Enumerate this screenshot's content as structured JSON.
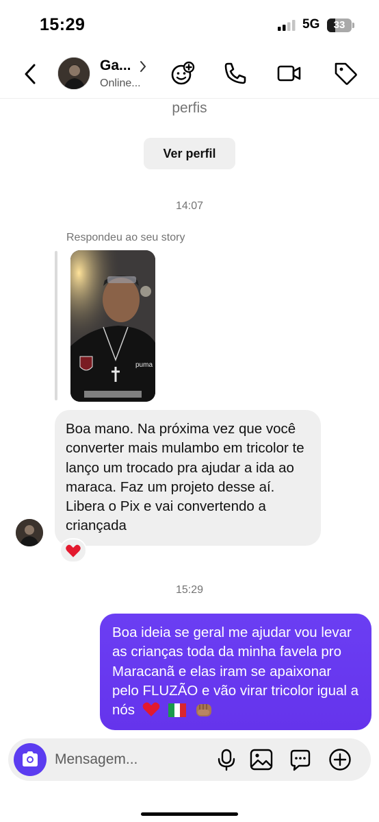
{
  "status_bar": {
    "time": "15:29",
    "network": "5G",
    "battery": "33"
  },
  "header": {
    "contact_name": "Ga...",
    "contact_status": "Online...",
    "icons": [
      "back-chevron-icon",
      "add-sticker-icon",
      "phone-icon",
      "video-camera-icon",
      "tag-icon"
    ]
  },
  "chat": {
    "profile_fragment": "perfis",
    "view_profile_label": "Ver perfil",
    "timestamp_1": "14:07",
    "reply_label": "Respondeu ao seu story",
    "incoming_message": "Boa mano. Na próxima vez que você converter mais mulambo em tricolor te lanço um trocado pra ajudar a ida ao maraca. Faz um projeto desse aí. Libera o Pix e vai convertendo a criançada",
    "reaction": "❤️",
    "timestamp_2": "15:29",
    "outgoing_message": "Boa ideia se geral me ajudar vou levar as crianças toda da minha favela pro Maracanã e elas iram se apaixonar pelo FLUZÃO e vão virar tricolor igual a nós",
    "outgoing_emojis": "❤️ 🇮🇹 👊🏽"
  },
  "composer": {
    "placeholder": "Mensagem...",
    "icons": [
      "camera-icon",
      "microphone-icon",
      "image-icon",
      "chat-bubble-icon",
      "plus-circle-icon"
    ]
  },
  "colors": {
    "accent": "#5b3cf0",
    "outgoing_bubble": "#6534ec",
    "incoming_bubble": "#efefef",
    "muted_text": "#737373"
  }
}
